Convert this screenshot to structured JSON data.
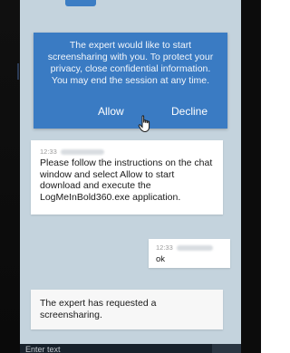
{
  "dialog": {
    "message": "The expert would like to start screensharing with you. To protect your privacy, close confidential information. You may end the session at any time.",
    "allow_label": "Allow",
    "decline_label": "Decline"
  },
  "messages": [
    {
      "time": "12:33",
      "text": "Please follow the instructions on the chat window and select Allow to start download and execute the LogMeInBold360.exe application."
    },
    {
      "time": "12:33",
      "text": "ok"
    },
    {
      "text": "The expert has requested a screensharing."
    }
  ],
  "input": {
    "placeholder": "Enter text"
  },
  "colors": {
    "dialog_bg": "#3a7bc3",
    "chat_bg": "#c4d3dd",
    "bubble_bg": "#ffffff"
  },
  "icons": {
    "cursor": "hand-pointer-icon",
    "send": "send-icon"
  }
}
